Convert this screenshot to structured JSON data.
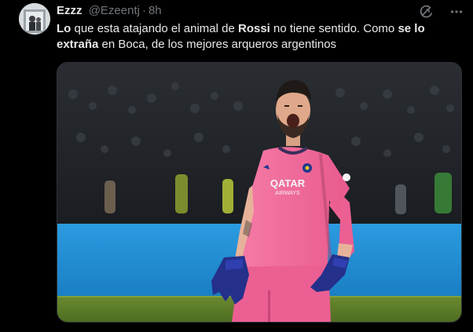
{
  "tweet": {
    "author_name": "Ezzz",
    "author_handle": "@Ezeentj",
    "separator": "·",
    "time": "8h",
    "text_segments": [
      {
        "text": "Lo",
        "bold": true
      },
      {
        "text": " que esta atajando el animal de ",
        "bold": false
      },
      {
        "text": "Rossi",
        "bold": true
      },
      {
        "text": " no tiene sentido. Como ",
        "bold": false
      },
      {
        "text": "se lo extraña",
        "bold": true
      },
      {
        "text": " en Boca, de los mejores arqueros argentinos",
        "bold": false
      }
    ],
    "media": {
      "jersey_sponsor_line1": "QATAR",
      "jersey_sponsor_line2": "AIRWAYS"
    },
    "icons": [
      "avatar",
      "grok-icon",
      "more-icon"
    ]
  },
  "colors": {
    "background": "#000000",
    "text": "#e7e9ea",
    "secondary": "#71767b",
    "jersey_pink": "#f06292",
    "ad_board_blue": "#1f8fd6",
    "pitch_green": "#5a7a2a"
  }
}
